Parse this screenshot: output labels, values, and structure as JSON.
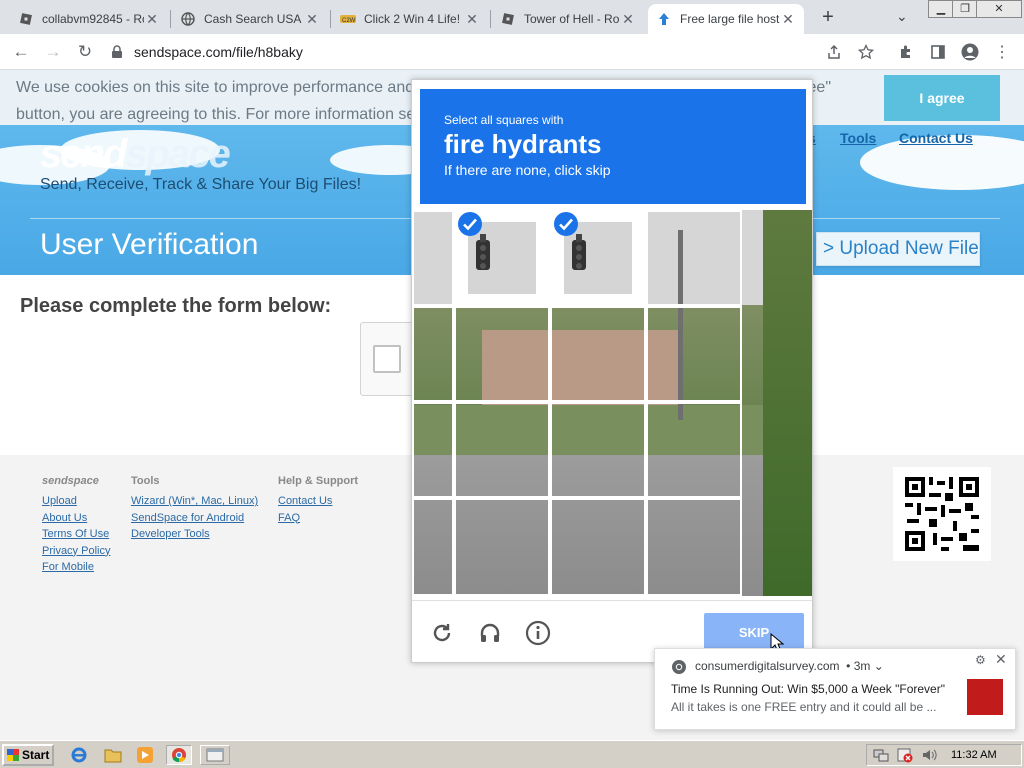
{
  "browser": {
    "tabs": [
      {
        "title": "collabvm92845 - Ro",
        "icon": "roblox-icon"
      },
      {
        "title": "Cash Search USA",
        "icon": "globe-icon"
      },
      {
        "title": "Click 2 Win 4 Life!",
        "icon": "site-logo-icon"
      },
      {
        "title": "Tower of Hell - Robl",
        "icon": "roblox-icon"
      },
      {
        "title": "Free large file hosti",
        "icon": "upload-arrow-icon",
        "active": true
      }
    ],
    "url": "sendspace.com/file/h8baky"
  },
  "cookie_banner": {
    "text": "We use cookies on this site to improve performance and for analytics. By browsing this site, or clicking the \"I agree\" button, you are agreeing to this. For more information see our P",
    "agree_label": "I agree"
  },
  "site": {
    "logo_dark": "send",
    "logo_light": "space",
    "tagline": "Send, Receive, Track & Share Your Big Files!",
    "nav": [
      "s",
      "Tools",
      "Contact Us"
    ],
    "page_title": "User Verification",
    "upload_button": "> Upload New File",
    "form_heading": "Please complete the form below:"
  },
  "footer": {
    "col1": {
      "head": "sendspace",
      "links": [
        "Upload",
        "About Us",
        "Terms Of Use",
        "Privacy Policy",
        "For Mobile"
      ]
    },
    "col2": {
      "head": "Tools",
      "links": [
        "Wizard (Win*, Mac, Linux)",
        "SendSpace for Android",
        "Developer Tools"
      ]
    },
    "col3": {
      "head": "Help & Support",
      "links": [
        "Contact Us",
        "FAQ"
      ]
    }
  },
  "captcha": {
    "instruction": "Select all squares with",
    "target": "fire hydrants",
    "hint": "If there are none, click skip",
    "selected_cells": [
      1,
      2
    ],
    "skip_label": "SKIP",
    "accent": "#1a73e8"
  },
  "notification": {
    "site": "consumerdigitalsurvey.com",
    "age": "• 3m",
    "title": "Time Is Running Out: Win $5,000 a Week \"Forever\"",
    "body": "All it takes is one FREE entry and it could all be ..."
  },
  "taskbar": {
    "start_label": "Start",
    "clock": "11:32 AM"
  }
}
